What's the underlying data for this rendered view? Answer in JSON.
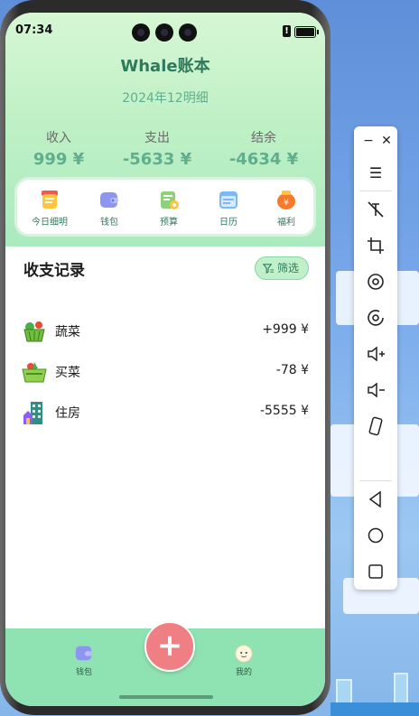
{
  "status": {
    "time": "07:34",
    "alert_glyph": "!"
  },
  "app": {
    "title": "Whale账本",
    "subtitle": "2024年12明细"
  },
  "summary": [
    {
      "label": "收入",
      "value": "999 ¥"
    },
    {
      "label": "支出",
      "value": "-5633 ¥"
    },
    {
      "label": "结余",
      "value": "-4634 ¥"
    }
  ],
  "quick": [
    {
      "label": "今日细明",
      "icon": "daily-detail-icon"
    },
    {
      "label": "钱包",
      "icon": "wallet-icon"
    },
    {
      "label": "预算",
      "icon": "budget-icon"
    },
    {
      "label": "日历",
      "icon": "calendar-icon"
    },
    {
      "label": "福利",
      "icon": "welfare-icon"
    }
  ],
  "records_section": {
    "title": "收支记录",
    "filter_label": "筛选"
  },
  "records": [
    {
      "name": "蔬菜",
      "amount": "+999 ¥",
      "icon": "vegetable-basket-icon"
    },
    {
      "name": "买菜",
      "amount": "-78 ¥",
      "icon": "grocery-basket-icon"
    },
    {
      "name": "住房",
      "amount": "-5555 ¥",
      "icon": "building-icon"
    }
  ],
  "tabbar": {
    "left_label": "钱包",
    "right_label": "我的",
    "add_glyph": "+"
  },
  "toolbar": {
    "items": [
      "minimize-icon",
      "close-icon",
      "menu-icon",
      "no-touch-icon",
      "crop-icon",
      "rotate-left-icon",
      "rotate-right-icon",
      "volume-up-icon",
      "volume-down-icon",
      "shake-icon",
      "back-icon",
      "home-icon",
      "recents-icon"
    ]
  },
  "colors": {
    "accent": "#5fae8e",
    "title": "#2f7a5c",
    "tabbar": "#8fe2b2",
    "add_button": "#f07f84"
  }
}
